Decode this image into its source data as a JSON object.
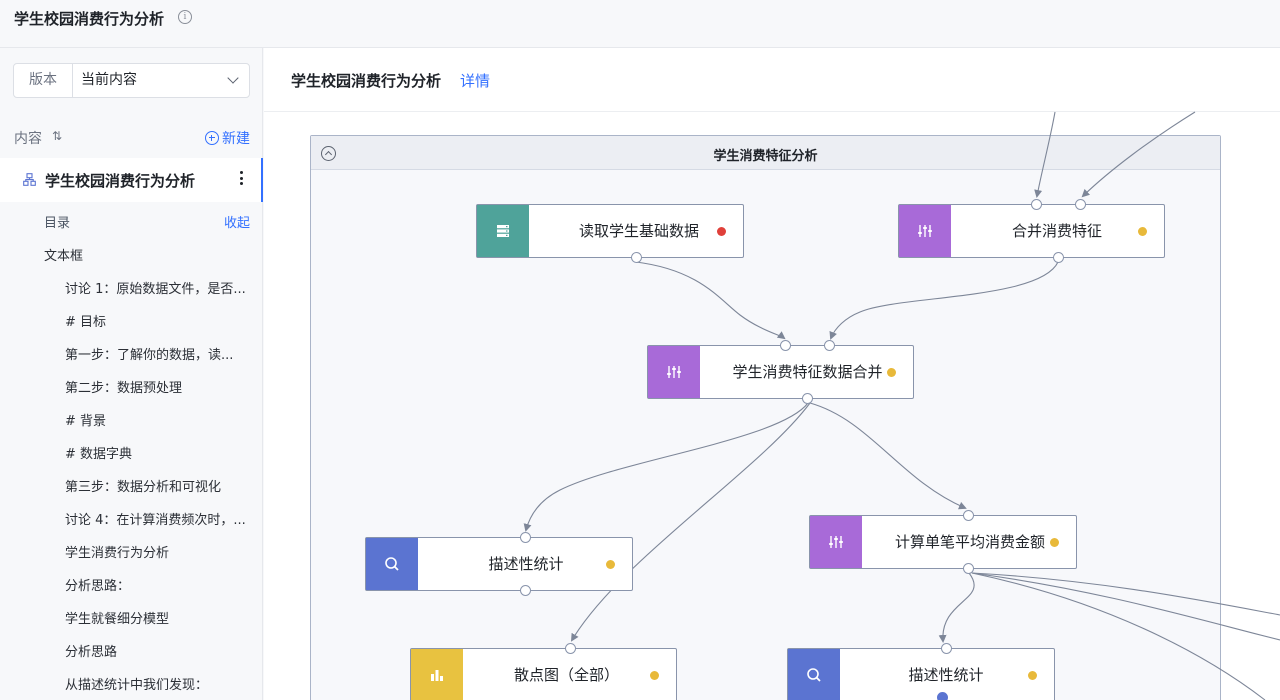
{
  "topbar": {
    "title": "学生校园消费行为分析",
    "info_icon": "info-icon"
  },
  "sidebar": {
    "version_label": "版本",
    "version_value": "当前内容",
    "content_label": "内容",
    "new_label": "新建",
    "doc_title": "学生校园消费行为分析",
    "toc_label": "目录",
    "collapse_label": "收起",
    "outline": [
      "文本框",
      "讨论 1：原始数据文件，是否...",
      "# 目标",
      "第一步：了解你的数据，读...",
      "第二步：数据预处理",
      "# 背景",
      "# 数据字典",
      "第三步：数据分析和可视化",
      "讨论 4：在计算消费频次时，...",
      "学生消费行为分析",
      "分析思路：",
      "学生就餐细分模型",
      "分析思路",
      "从描述统计中我们发现："
    ]
  },
  "main": {
    "title": "学生校园消费行为分析",
    "detail_link": "详情",
    "group_title": "学生消费特征分析",
    "nodes": [
      {
        "label": "读取学生基础数据",
        "icon": "database-icon",
        "color": "#4fa39a",
        "status": "#e0403a"
      },
      {
        "label": "合并消费特征",
        "icon": "sliders-icon",
        "color": "#a86ad8",
        "status": "#e8b93a"
      },
      {
        "label": "学生消费特征数据合并",
        "icon": "sliders-icon",
        "color": "#a86ad8",
        "status": "#e8b93a"
      },
      {
        "label": "描述性统计",
        "icon": "search-icon",
        "color": "#5b74d1",
        "status": "#e8b93a"
      },
      {
        "label": "计算单笔平均消费金额",
        "icon": "sliders-icon",
        "color": "#a86ad8",
        "status": "#e8b93a"
      },
      {
        "label": "散点图（全部）",
        "icon": "bar-chart-icon",
        "color": "#e8c240",
        "status": "#e8b93a"
      },
      {
        "label": "描述性统计",
        "icon": "search-icon",
        "color": "#5b74d1",
        "status": "#e8b93a"
      }
    ]
  }
}
